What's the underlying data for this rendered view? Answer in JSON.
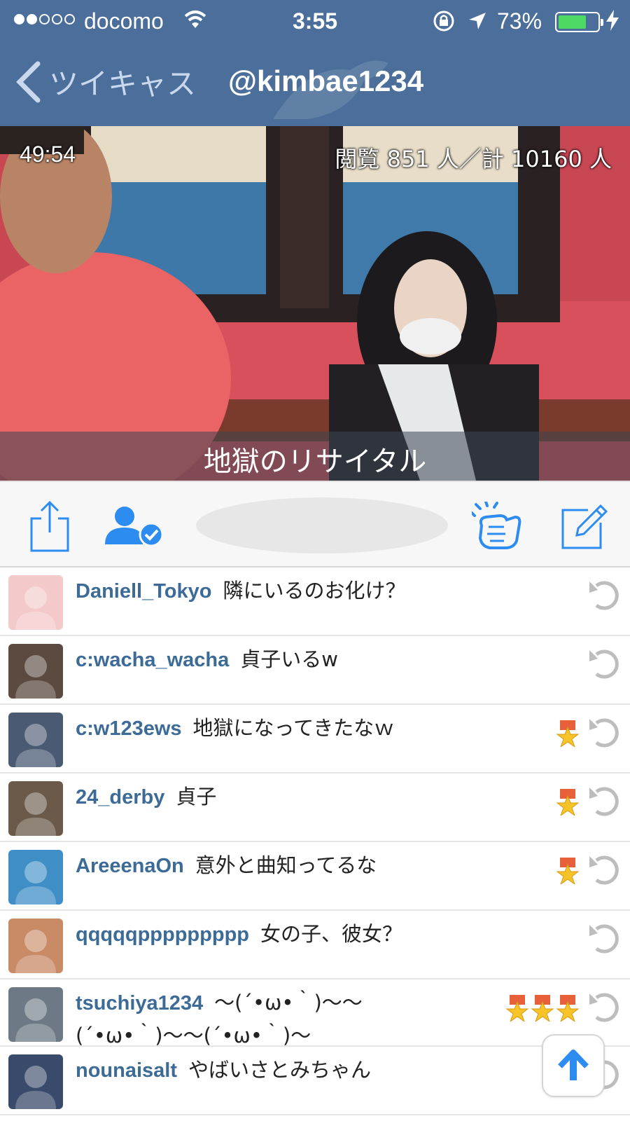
{
  "status_bar": {
    "carrier": "docomo",
    "time": "3:55",
    "battery": "73%",
    "battery_level": 0.73,
    "signal_bars_filled": 2,
    "signal_bars_total": 5
  },
  "nav": {
    "back_label": "ツイキャス",
    "title": "@kimbae1234"
  },
  "video": {
    "elapsed": "49:54",
    "viewers": "閲覧 851 人／計 10160 人",
    "caption": "地獄のリサイタル"
  },
  "toolbar": {
    "share_icon": "share-icon",
    "follow_icon": "user-check-icon",
    "clap_icon": "clap-icon",
    "compose_icon": "compose-icon"
  },
  "comments": [
    {
      "user": "Daniell_Tokyo",
      "text": "隣にいるのお化け？",
      "medals": 0,
      "avatar_color": "#f3c9c9"
    },
    {
      "user": "c:wacha_wacha",
      "text": "貞子いるw",
      "medals": 0,
      "avatar_color": "#5b4a3f"
    },
    {
      "user": "c:w123ews",
      "text": "地獄になってきたなｗ",
      "medals": 1,
      "avatar_color": "#4a5a73"
    },
    {
      "user": "24_derby",
      "text": "貞子",
      "medals": 1,
      "avatar_color": "#6b5a4a"
    },
    {
      "user": "AreeenaOn",
      "text": "意外と曲知ってるな",
      "medals": 1,
      "avatar_color": "#3f8fc6"
    },
    {
      "user": "qqqqqppppppppp",
      "text": "女の子、彼女？",
      "medals": 0,
      "avatar_color": "#c98a66"
    },
    {
      "user": "tsuchiya1234",
      "text": "～(´•ω•｀)～～(´•ω•｀)～～(´•ω•｀)～",
      "medals": 3,
      "avatar_color": "#6d7a86"
    },
    {
      "user": "nounaisalt",
      "text": "やばいさとみちゃん",
      "medals": 0,
      "avatar_color": "#3a4a6a"
    }
  ],
  "colors": {
    "nav_bg": "#4b6e9a",
    "username": "#3c6b98",
    "accent": "#2d8cf0"
  }
}
